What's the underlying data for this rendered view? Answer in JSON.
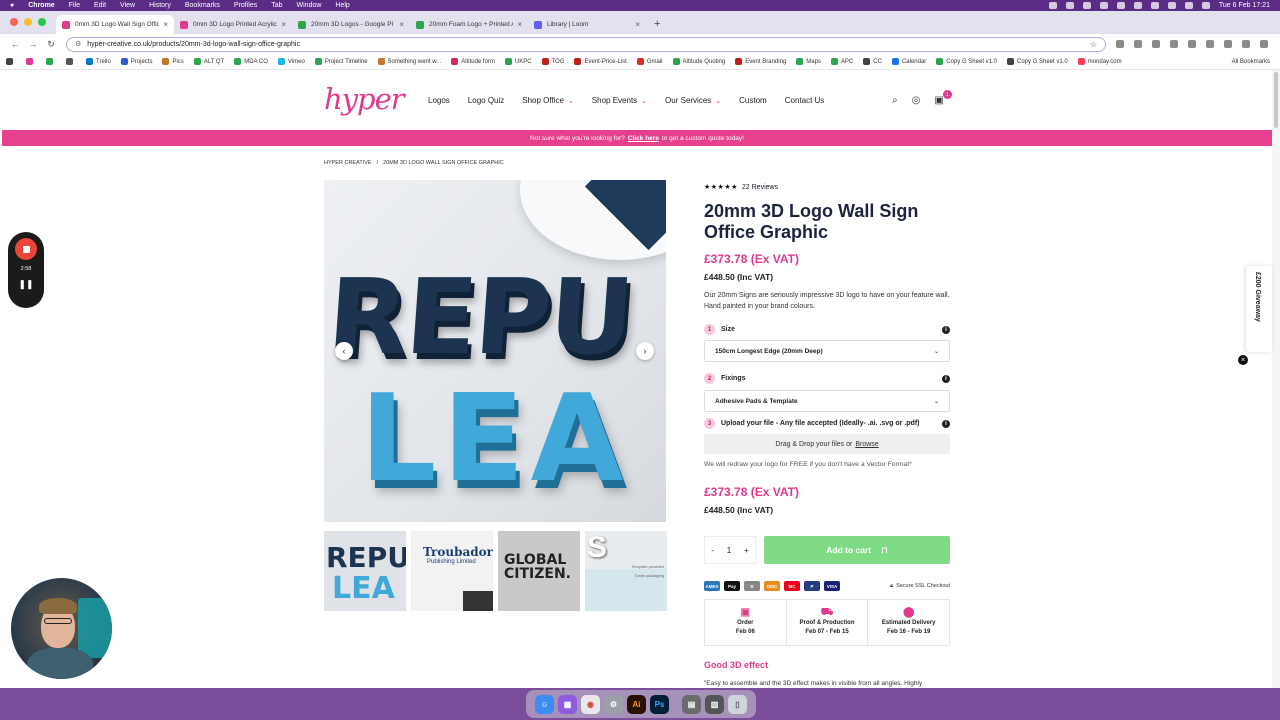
{
  "menubar": {
    "apple": "",
    "items": [
      "Chrome",
      "File",
      "Edit",
      "View",
      "History",
      "Bookmarks",
      "Profiles",
      "Tab",
      "Window",
      "Help"
    ],
    "clock": "Tue 6 Feb  17:21"
  },
  "tabs": [
    {
      "title": "0mm 3D Logo Wall Sign Offic",
      "color": "#e03a8c"
    },
    {
      "title": "0mm 3D Logo Printed Acrylic",
      "color": "#e03a8c"
    },
    {
      "title": "20mm 3D Logos - Google Pl",
      "color": "#2da44e"
    },
    {
      "title": "20mm Foam Logo + Printed A",
      "color": "#2da44e"
    },
    {
      "title": "Library | Loom",
      "color": "#625df5"
    }
  ],
  "toolbar": {
    "url": "hyper-creative.co.uk/products/20mm-3d-logo-wall-sign-office-graphic"
  },
  "bookmarks": [
    {
      "label": "",
      "color": "#444"
    },
    {
      "label": "",
      "color": "#e03a8c"
    },
    {
      "label": "",
      "color": "#2da44e"
    },
    {
      "label": "",
      "color": "#555"
    },
    {
      "label": "Trello",
      "color": "#0079bf"
    },
    {
      "label": "Projects",
      "color": "#2d5bd6"
    },
    {
      "label": "Pics",
      "color": "#c0772b"
    },
    {
      "label": "ALT QT",
      "color": "#2da44e"
    },
    {
      "label": "MDA CO",
      "color": "#2da44e"
    },
    {
      "label": "Vimeo",
      "color": "#1ab7ea"
    },
    {
      "label": "Project Timeline",
      "color": "#2da44e"
    },
    {
      "label": "Something went w...",
      "color": "#c0772b"
    },
    {
      "label": "Altitude form",
      "color": "#d02b5a"
    },
    {
      "label": "UKPC",
      "color": "#2da44e"
    },
    {
      "label": "TOG",
      "color": "#c0201b"
    },
    {
      "label": "Event-Price-List",
      "color": "#c0201b"
    },
    {
      "label": "Gmail",
      "color": "#d93025"
    },
    {
      "label": "Altitude Quoting",
      "color": "#2da44e"
    },
    {
      "label": "Event Branding",
      "color": "#c0201b"
    },
    {
      "label": "Maps",
      "color": "#2da44e"
    },
    {
      "label": "APC",
      "color": "#2da44e"
    },
    {
      "label": "CC",
      "color": "#444"
    },
    {
      "label": "Calendar",
      "color": "#1a73e8"
    },
    {
      "label": "Copy G Sheet v1.0",
      "color": "#2da44e"
    },
    {
      "label": "Copy G Sheet v1.0",
      "color": "#444"
    },
    {
      "label": "monday.com",
      "color": "#ff3d57"
    }
  ],
  "bookmarks_all": "All Bookmarks",
  "site": {
    "logo": "hyper",
    "nav": [
      {
        "label": "Logos",
        "dropdown": false
      },
      {
        "label": "Logo Quiz",
        "dropdown": false
      },
      {
        "label": "Shop Office",
        "dropdown": true
      },
      {
        "label": "Shop Events",
        "dropdown": true
      },
      {
        "label": "Our Services",
        "dropdown": true
      },
      {
        "label": "Custom",
        "dropdown": false
      },
      {
        "label": "Contact Us",
        "dropdown": false
      }
    ],
    "cart_count": "1",
    "promo_before": "Not sure what you're looking for?",
    "promo_link": "Click here",
    "promo_after": "to get a custom quote today!",
    "breadcrumb": [
      "HYPER CREATIVE",
      "/",
      "20MM 3D LOGO WALL SIGN OFFICE GRAPHIC"
    ]
  },
  "gallery": {
    "main_text_top": "REPU",
    "main_text_bottom": "LEA",
    "thumb2_title": "Troubador",
    "thumb2_sub": "Publishing Limited",
    "thumb3_line1": "GLOBAL",
    "thumb3_line2": "CITIZEN.",
    "thumb4_label1": "Template provided",
    "thumb4_label2": "Great packaging"
  },
  "product": {
    "stars": "★★★★★",
    "reviews": "22 Reviews",
    "title": "20mm 3D Logo Wall Sign Office Graphic",
    "price_ex_vat": "£373.78 (Ex VAT)",
    "price_inc_vat": "£448.50 (Inc VAT)",
    "description": "Our 20mm Signs are seriously impressive 3D logo to have on your feature wall. Hand painted in your brand colours.",
    "options": [
      {
        "num": "1",
        "label": "Size",
        "value": "150cm Longest Edge (20mm Deep)"
      },
      {
        "num": "2",
        "label": "Fixings",
        "value": "Adhesive Pads & Template"
      },
      {
        "num": "3",
        "label": "Upload your file - Any file accepted (Ideally- .ai. .svg or .pdf)",
        "value": ""
      }
    ],
    "dropzone_text": "Drag & Drop your files or",
    "dropzone_link": "Browse",
    "redraw": "We will redraw your logo for FREE if you don't have a Vector Format*",
    "qty_minus": "-",
    "qty_value": "1",
    "qty_plus": "+",
    "add_to_cart": "Add to cart",
    "payments": [
      {
        "label": "AMEX",
        "color": "#2e77bb"
      },
      {
        "label": "Pay",
        "color": "#111"
      },
      {
        "label": "D",
        "color": "#888"
      },
      {
        "label": "DISC",
        "color": "#e88b1a"
      },
      {
        "label": "MC",
        "color": "#eb001b"
      },
      {
        "label": "P",
        "color": "#253b80"
      },
      {
        "label": "VISA",
        "color": "#1a1f71"
      }
    ],
    "secure": "Secure SSL Checkout",
    "timeline": [
      {
        "title": "Order",
        "date": "Feb 06",
        "icon": "bag-icon"
      },
      {
        "title": "Proof & Production",
        "date": "Feb 07 - Feb 15",
        "icon": "truck-icon"
      },
      {
        "title": "Estimated Delivery",
        "date": "Feb 16 - Feb 19",
        "icon": "pin-icon"
      }
    ],
    "good_heading": "Good 3D effect",
    "quote": "\"Easy to assemble and the 3D effect makes in visible from all angles. Highly"
  },
  "giveaway": "£200 Giveaway",
  "loom": {
    "time": "2:58"
  },
  "colors": {
    "brand": "#e03a8c",
    "add_to_cart": "#7fdc84",
    "menubar": "#5b2c86"
  }
}
